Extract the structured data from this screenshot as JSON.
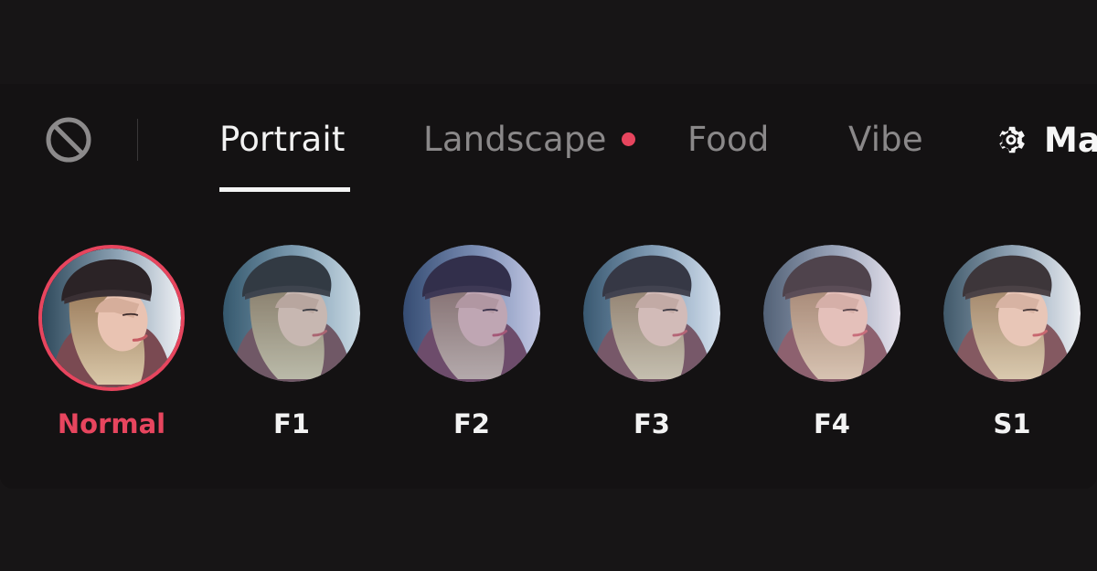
{
  "tabs": [
    {
      "label": "Portrait",
      "active": true
    },
    {
      "label": "Landscape",
      "active": false,
      "badge_dot": true
    },
    {
      "label": "Food",
      "active": false
    },
    {
      "label": "Vibe",
      "active": false
    }
  ],
  "manage": {
    "label": "Ma",
    "icon": "gear-icon"
  },
  "none_button": {
    "icon": "no-filter-icon"
  },
  "filters": [
    {
      "label": "Normal",
      "selected": true,
      "tint": "#d8d4d9",
      "tint_opacity": 0
    },
    {
      "label": "F1",
      "selected": false,
      "tint": "#4e8dac",
      "tint_opacity": 0.22
    },
    {
      "label": "F2",
      "selected": false,
      "tint": "#4a56b6",
      "tint_opacity": 0.26
    },
    {
      "label": "F3",
      "selected": false,
      "tint": "#6b9ad2",
      "tint_opacity": 0.18
    },
    {
      "label": "F4",
      "selected": false,
      "tint": "#d2b6d6",
      "tint_opacity": 0.22
    },
    {
      "label": "S1",
      "selected": false,
      "tint": "#e3e6ee",
      "tint_opacity": 0.1
    }
  ],
  "colors": {
    "accent": "#e7455e",
    "background": "#171516",
    "panel": "#141213",
    "tab_inactive": "#8a8889",
    "tab_active": "#f2f2f2"
  }
}
